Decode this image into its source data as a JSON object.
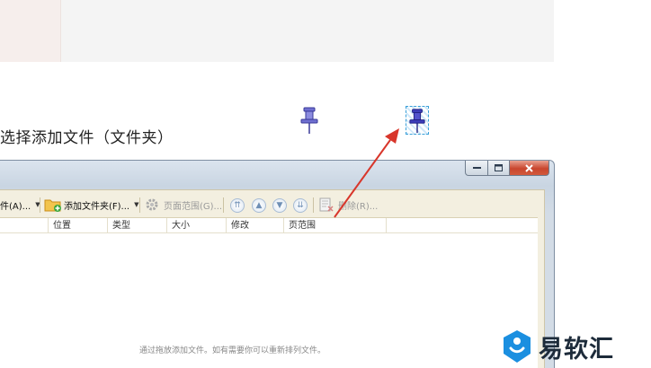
{
  "instruction": {
    "text": "选择添加文件（文件夹）"
  },
  "toolbar": {
    "add_file_label": "件(A)...",
    "add_folder_label": "添加文件夹(F)...",
    "page_range_label": "页面范围(G)...",
    "delete_label": "删除(R)..."
  },
  "columns": [
    "位置",
    "类型",
    "大小",
    "修改",
    "页范围"
  ],
  "list": {
    "hint": "通过拖放添加文件。如有需要你可以重新排列文件。"
  },
  "watermark": {
    "brand": "易软汇"
  },
  "colors": {
    "arrow": "#d8362b",
    "pin": "#4a4ab8",
    "brand": "#1b8fe0",
    "close_button": "#c9462e"
  },
  "icons": [
    "folder-add-icon",
    "gear-icon",
    "arrow-first-icon",
    "arrow-up-icon",
    "arrow-down-icon",
    "arrow-last-icon",
    "delete-icon",
    "pushpin-icon"
  ]
}
